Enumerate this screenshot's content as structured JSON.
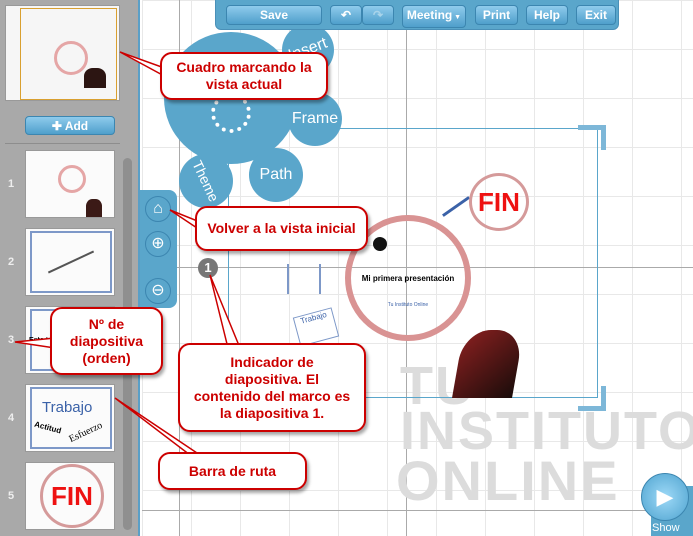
{
  "toolbar": {
    "save": "Save",
    "undo_icon": "undo-icon",
    "redo_icon": "redo-icon",
    "meeting": "Meeting",
    "print": "Print",
    "help": "Help",
    "exit": "Exit"
  },
  "sidebar": {
    "add": "Add",
    "slides": [
      {
        "num": "1"
      },
      {
        "num": "2"
      },
      {
        "num": "3",
        "text": "Este te"
      },
      {
        "num": "4",
        "t1": "Trabajo",
        "t2": "Actitud",
        "t3": "Esfuerzo"
      },
      {
        "num": "5",
        "text": "FIN"
      }
    ]
  },
  "bubbles": {
    "insert": "Insert",
    "frame": "Frame",
    "path": "Path",
    "theme": "Theme"
  },
  "canvas": {
    "marker": "1",
    "title": "Mi primera presentación",
    "subtitle": "Tu Instituto Online",
    "fin": "FIN",
    "trabajo": "Trabajo",
    "actitud": "Actitud",
    "esfuerzo": "Esfuerzo",
    "watermark": [
      "TU",
      "INSTITUTO",
      "ONLINE"
    ]
  },
  "show": "Show",
  "callouts": {
    "current_view": "Cuadro marcando la vista actual",
    "home": "Volver a la vista inicial",
    "slide_num": "Nº de diapositiva (orden)",
    "indicator": "Indicador de diapositiva. El contenido del marco es la diapositiva 1.",
    "path_bar": "Barra de ruta"
  },
  "colors": {
    "accent": "#5aa6cb",
    "callout": "#cc0000"
  }
}
